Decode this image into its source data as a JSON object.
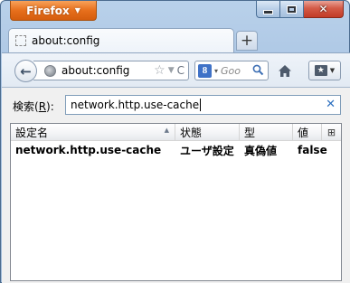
{
  "app": {
    "menu_button_label": "Firefox",
    "menu_button_caret": "▼"
  },
  "window_controls": {
    "close_glyph": "✕"
  },
  "tab": {
    "title": "about:config"
  },
  "new_tab": {
    "label": "+"
  },
  "navbar": {
    "back_glyph": "←",
    "url": "about:config",
    "star_glyph": "☆",
    "dropmarker_glyph": "▼",
    "reload_glyph": "C",
    "search_engine_letter": "8",
    "search_dropmarker": "▾",
    "search_placeholder": "Goo"
  },
  "filter": {
    "label_prefix": "検索(",
    "label_accesskey": "R",
    "label_suffix": "):",
    "value": "network.http.use-cache",
    "clear_glyph": "✕"
  },
  "table": {
    "columns": [
      "設定名",
      "状態",
      "型",
      "値"
    ],
    "sort_glyph": "▲",
    "picker_glyph": "⊞",
    "rows": [
      {
        "name": "network.http.use-cache",
        "status": "ユーザ設定",
        "type": "真偽値",
        "value": "false"
      }
    ]
  },
  "colors": {
    "firefox_button": "#e76f1c",
    "close_button": "#c23b27",
    "frame": "#a9c4e3",
    "accent_link": "#2c6fbf"
  }
}
